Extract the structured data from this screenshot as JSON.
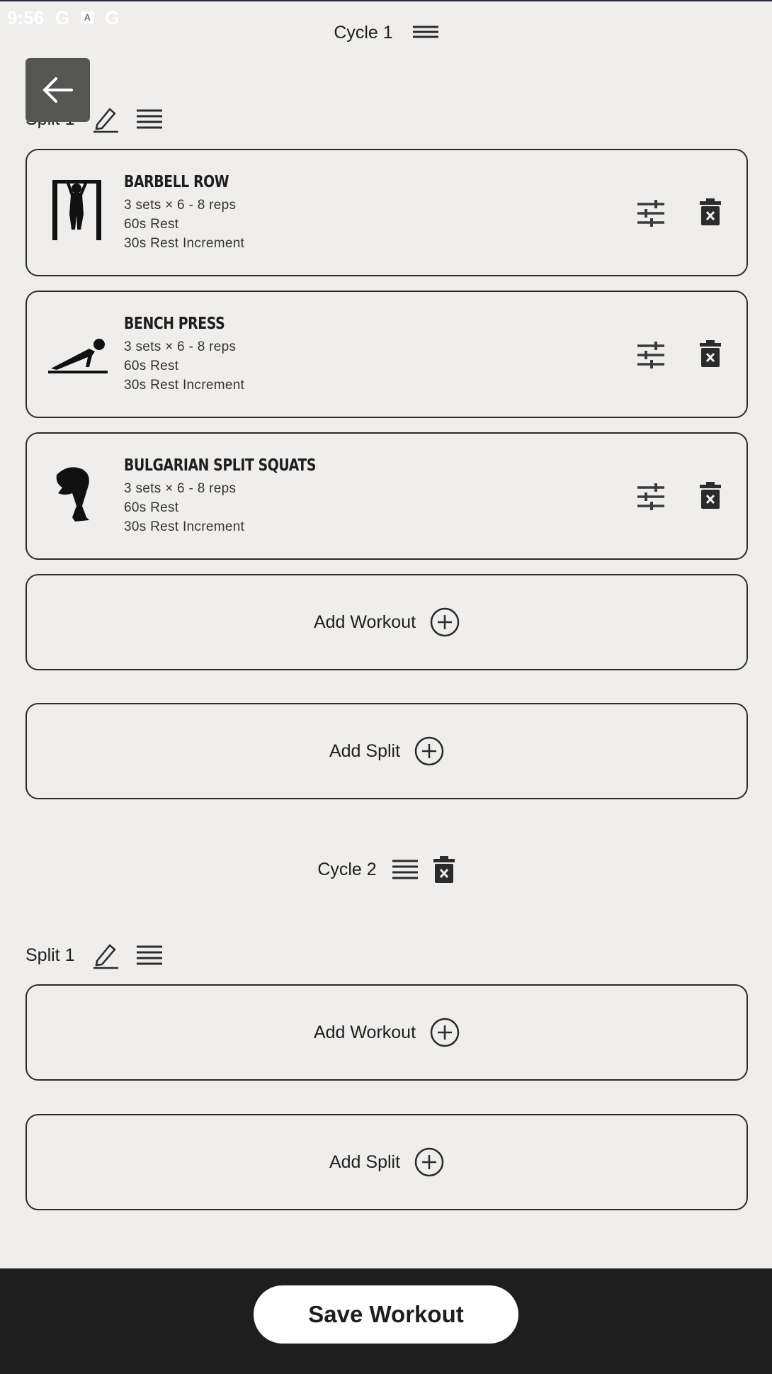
{
  "status_bar": {
    "time": "9:56",
    "icons": [
      "google-icon",
      "app-icon",
      "google-icon"
    ]
  },
  "cycle1": {
    "title": "Cycle 1"
  },
  "split1": {
    "title": "Split 1",
    "exercises": [
      {
        "name": "BARBELL ROW",
        "sets": "3 sets × 6 - 8 reps",
        "rest": "60s Rest",
        "increment": "30s Rest Increment",
        "icon": "pullup-figure-icon"
      },
      {
        "name": "BENCH PRESS",
        "sets": "3 sets × 6 - 8 reps",
        "rest": "60s Rest",
        "increment": "30s Rest Increment",
        "icon": "pushup-figure-icon"
      },
      {
        "name": "BULGARIAN SPLIT SQUATS",
        "sets": "3 sets × 6 - 8 reps",
        "rest": "60s Rest",
        "increment": "30s Rest Increment",
        "icon": "squat-figure-icon"
      }
    ],
    "add_workout_label": "Add Workout",
    "add_split_label": "Add Split"
  },
  "cycle2": {
    "title": "Cycle 2",
    "split1": {
      "title": "Split 1",
      "add_workout_label": "Add Workout",
      "add_split_label": "Add Split"
    }
  },
  "footer": {
    "save_label": "Save Workout"
  }
}
